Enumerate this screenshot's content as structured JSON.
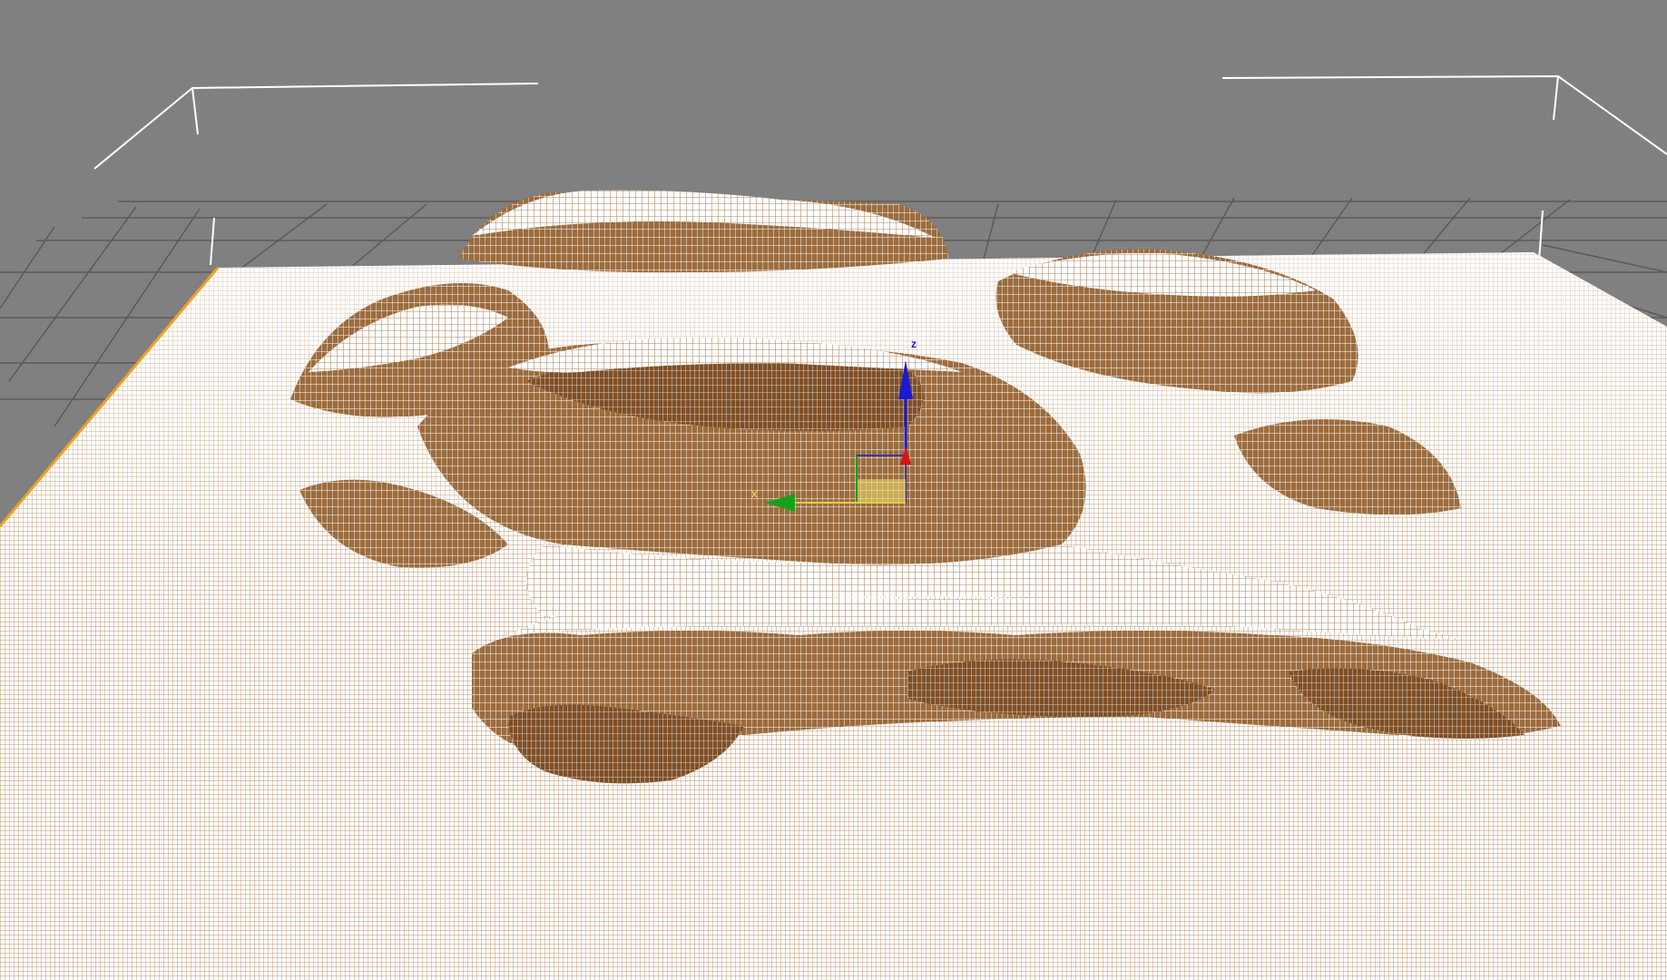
{
  "viewport": {
    "background_color": "#808080",
    "grid_color": "#5a5a5a",
    "selection_bracket_color": "#ffffff",
    "terrain_wireframe_color": "#ffffff",
    "terrain_fill_color": "#a87a4c",
    "terrain_shadow_color": "#7a4e28",
    "plane_edge_color": "#f0a020"
  },
  "gizmo": {
    "z_axis_label": "z",
    "x_axis_label": "x",
    "z_axis_color": "#1a1ad0",
    "y_axis_color": "#18a018",
    "x_axis_color": "#d01818",
    "plane_handle_color": "#f0e070"
  }
}
